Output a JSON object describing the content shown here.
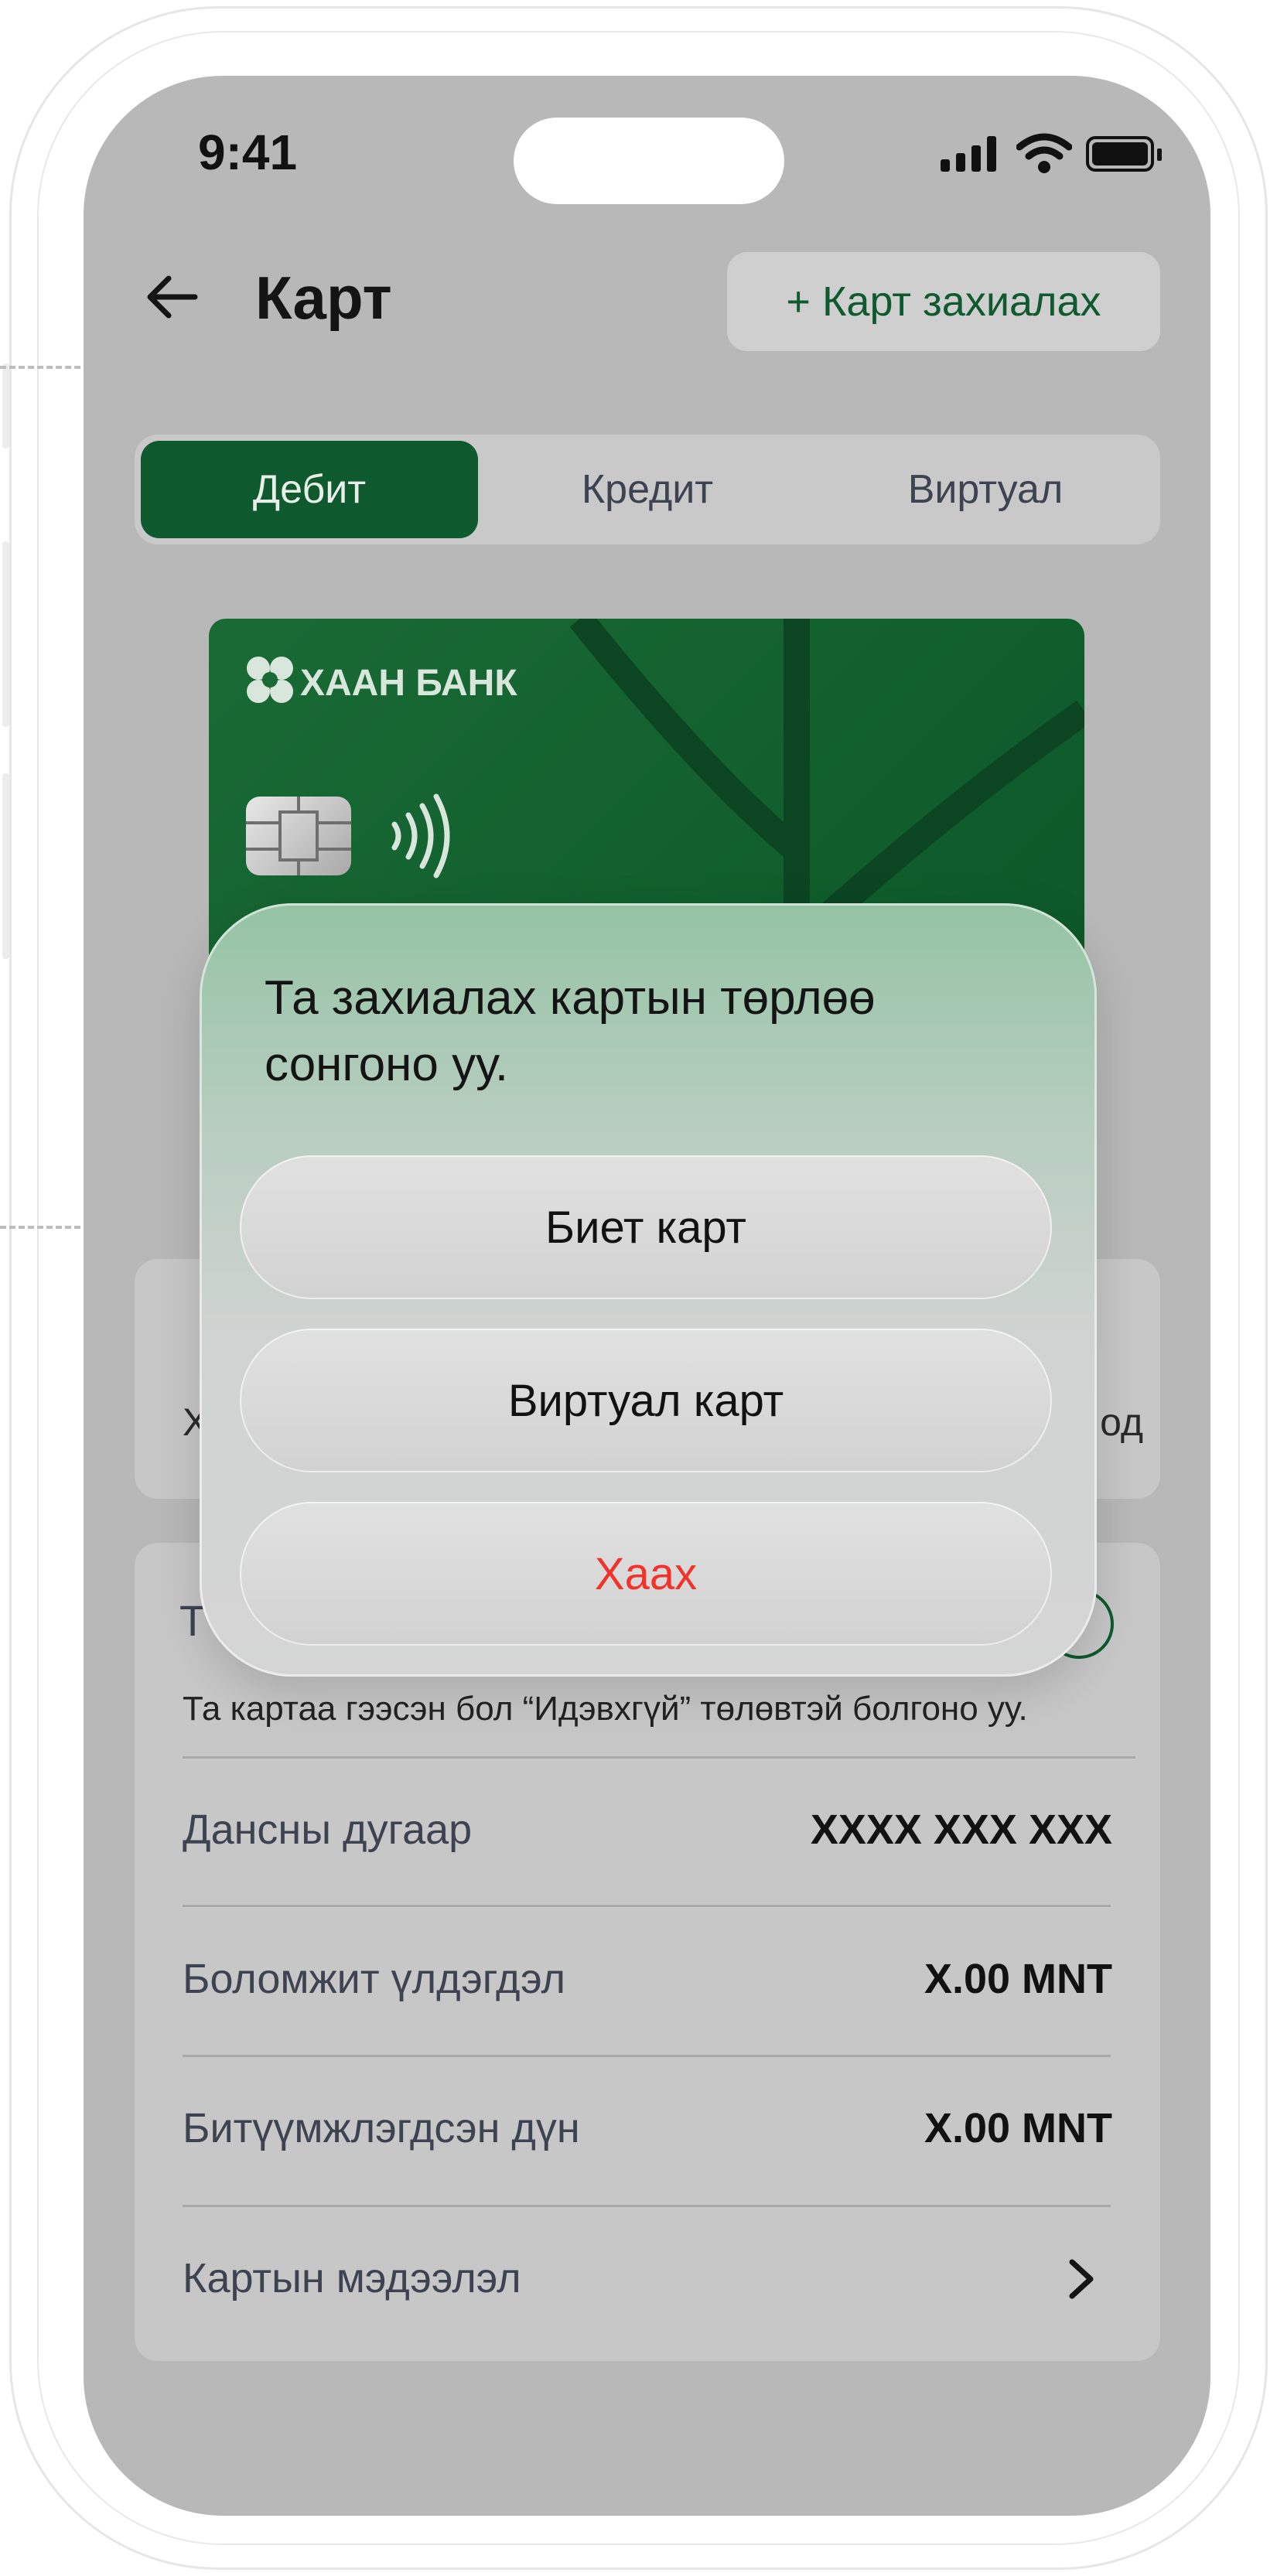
{
  "status_bar": {
    "time": "9:41"
  },
  "header": {
    "title": "Карт",
    "order_button": "+ Карт захиалах"
  },
  "tabs": [
    {
      "label": "Дебит",
      "active": true
    },
    {
      "label": "Кредит",
      "active": false
    },
    {
      "label": "Виртуал",
      "active": false
    }
  ],
  "card": {
    "bank_name": "ХААН БАНК"
  },
  "quick_actions": {
    "left_partial": "Х",
    "right_partial": "од"
  },
  "status_panel": {
    "title_partial": "Т",
    "hint": "Та картаа гээсэн бол “Идэвхгүй” төлөвтэй болгоно уу."
  },
  "details": [
    {
      "label": "Дансны дугаар",
      "value": "XXXX XXX XXX"
    },
    {
      "label": "Боломжит үлдэгдэл",
      "value": "X.00 MNT"
    },
    {
      "label": "Битүүмжлэгдсэн дүн",
      "value": "X.00 MNT"
    },
    {
      "label": "Картын мэдээлэл",
      "value": ""
    }
  ],
  "modal": {
    "title": "Та захиалах картын төрлөө сонгоно уу.",
    "options": {
      "physical": "Биет карт",
      "virtual": "Виртуал карт",
      "close": "Хаах"
    }
  },
  "colors": {
    "brand_green": "#0e5a2e",
    "close_red": "#f0342b",
    "overlay_gray": "#b8b8b8"
  }
}
